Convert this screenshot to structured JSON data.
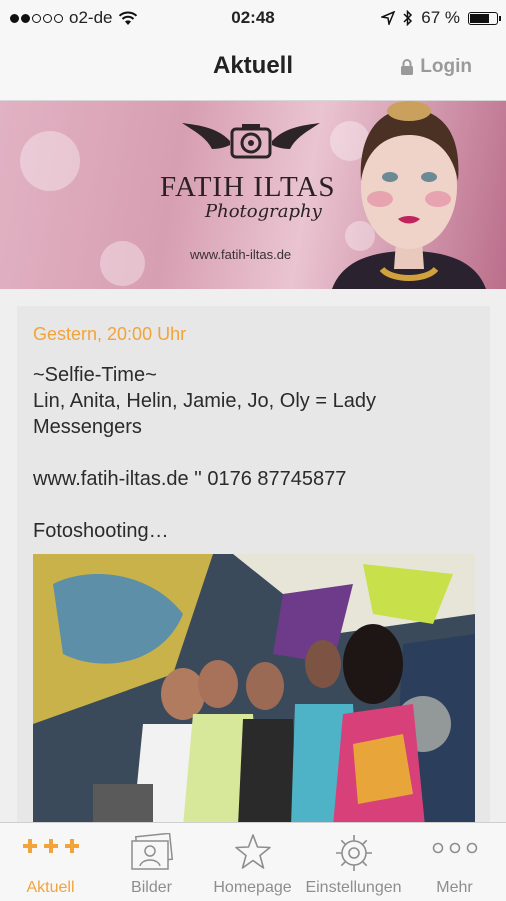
{
  "status_bar": {
    "carrier": "o2-de",
    "time": "02:48",
    "battery": "67 %",
    "battery_level": 0.67
  },
  "nav": {
    "title": "Aktuell",
    "login": "Login"
  },
  "banner": {
    "brand": "FATIH ILTAS",
    "subtitle": "Photography",
    "url": "www.fatih-iltas.de"
  },
  "post": {
    "date": "Gestern, 20:00 Uhr",
    "text": "~Selfie-Time~\nLin, Anita, Helin, Jamie, Jo, Oly = Lady Messengers\n\nwww.fatih-iltas.de '' 0176 87745877\n\nFotoshooting…"
  },
  "tabs": [
    {
      "label": "Aktuell",
      "icon": "plus-plus-plus-icon",
      "active": true
    },
    {
      "label": "Bilder",
      "icon": "photo-icon",
      "active": false
    },
    {
      "label": "Homepage",
      "icon": "star-icon",
      "active": false
    },
    {
      "label": "Einstellungen",
      "icon": "gear-icon",
      "active": false
    },
    {
      "label": "Mehr",
      "icon": "more-dots-icon",
      "active": false
    }
  ],
  "colors": {
    "accent": "#f2a33a",
    "inactive": "#8e8e8e"
  }
}
